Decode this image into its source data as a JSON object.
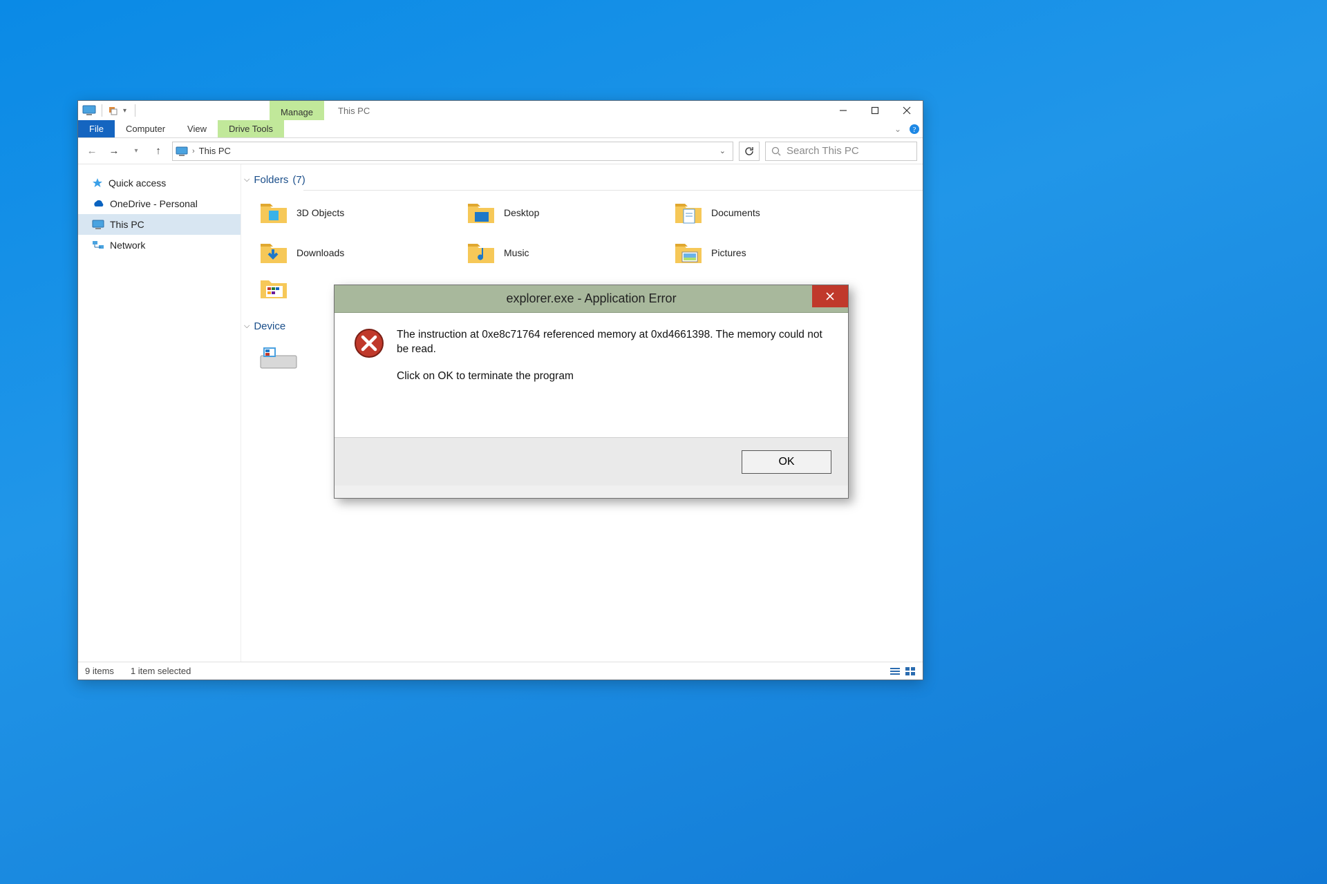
{
  "titlebar": {
    "context_tab": "Manage",
    "window_title": "This PC"
  },
  "ribbon": {
    "file": "File",
    "computer": "Computer",
    "view": "View",
    "drive_tools": "Drive Tools"
  },
  "address": {
    "crumb": "This PC"
  },
  "search": {
    "placeholder": "Search This PC"
  },
  "sidebar": {
    "quick_access": "Quick access",
    "onedrive": "OneDrive - Personal",
    "this_pc": "This PC",
    "network": "Network"
  },
  "groups": {
    "folders_label": "Folders",
    "folders_count": "(7)",
    "devices_label": "Device"
  },
  "folders": {
    "f0": "3D Objects",
    "f1": "Desktop",
    "f2": "Documents",
    "f3": "Downloads",
    "f4": "Music",
    "f5": "Pictures"
  },
  "status": {
    "items": "9 items",
    "selected": "1 item selected"
  },
  "dialog": {
    "title": "explorer.exe - Application Error",
    "line1": "The instruction at 0xe8c71764 referenced memory at 0xd4661398. The memory could not be read.",
    "line2": "Click on OK to terminate the program",
    "ok": "OK"
  }
}
